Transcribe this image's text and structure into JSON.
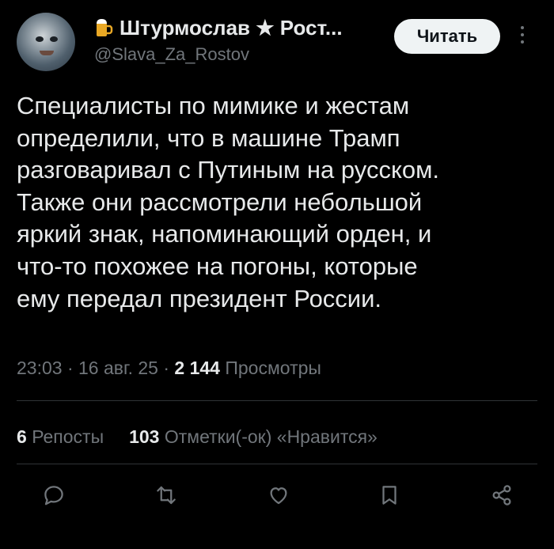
{
  "author": {
    "display_name": "Штурмослав ★ Рост...",
    "handle": "@Slava_Za_Rostov"
  },
  "follow_label": "Читать",
  "tweet": {
    "text": "Специалисты по мимике и жестам\nопределили, что в машине Трамп\nразговаривал с Путиным на русском.\nТакже они рассмотрели небольшой\nяркий знак, напоминающий орден, и\nчто-то похожее на погоны, которые\nему передал президент России.",
    "time": "23:03",
    "date": "16 авг. 25",
    "separator": "·",
    "views_count": "2 144",
    "views_label": "Просмотры"
  },
  "stats": {
    "reposts_count": "6",
    "reposts_label": "Репосты",
    "likes_count": "103",
    "likes_label": "Отметки(-ок) «Нравится»"
  },
  "icons": {
    "reply": "reply-icon",
    "repost": "repost-icon",
    "like": "heart-icon",
    "bookmark": "bookmark-icon",
    "share": "share-icon",
    "more": "more-vertical-icon",
    "badge": "beer-mug-icon"
  },
  "colors": {
    "background": "#000000",
    "text": "#e7e9ea",
    "secondary": "#71767b",
    "divider": "#2f3336",
    "button_bg": "#eff3f4"
  }
}
